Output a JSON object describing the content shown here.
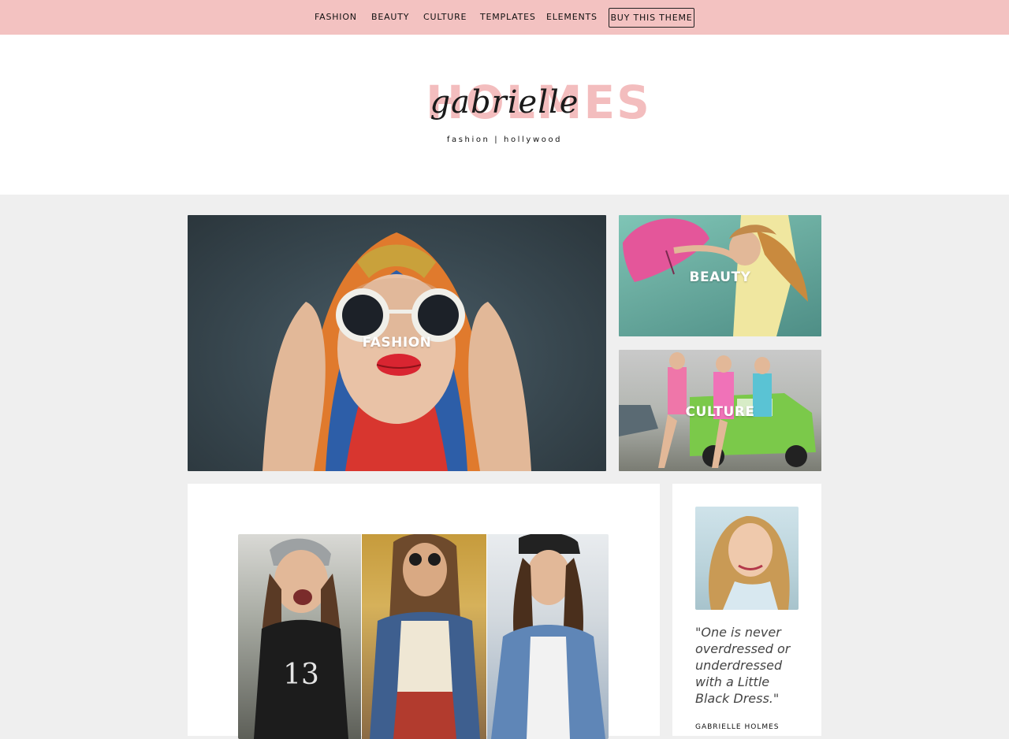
{
  "nav": {
    "items": [
      {
        "label": "FASHION"
      },
      {
        "label": "BEAUTY"
      },
      {
        "label": "CULTURE"
      },
      {
        "label": "TEMPLATES"
      },
      {
        "label": "ELEMENTS"
      }
    ],
    "cta_label": "BUY THIS THEME"
  },
  "header": {
    "logo_word": "HOLMES",
    "logo_script": "gabrielle",
    "tagline": "fashion | hollywood"
  },
  "features": [
    {
      "label": "FASHION"
    },
    {
      "label": "BEAUTY"
    },
    {
      "label": "CULTURE"
    }
  ],
  "sidebar": {
    "quote": "\"One is never overdressed or underdressed with a Little Black Dress.\"",
    "author": "GABRIELLE HOLMES"
  },
  "colors": {
    "nav_bg": "#f3c2c1",
    "accent_pink": "#f2b6b7",
    "page_bg": "#efefef"
  }
}
